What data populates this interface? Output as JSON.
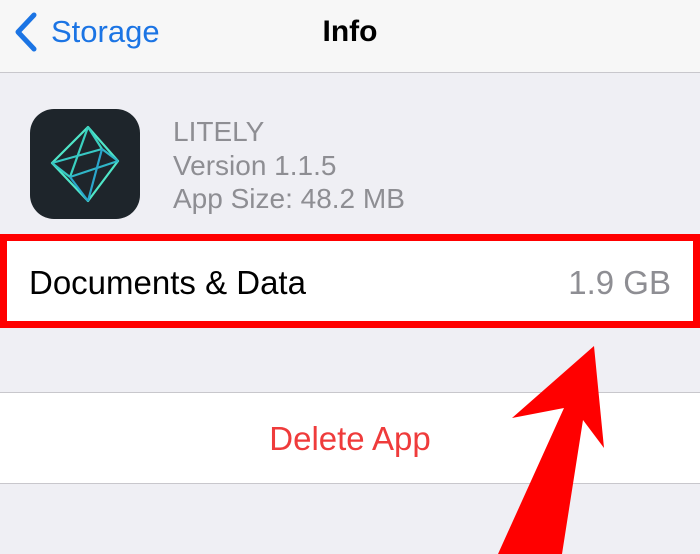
{
  "nav": {
    "back_label": "Storage",
    "title": "Info"
  },
  "app": {
    "name": "LITELY",
    "version": "Version 1.1.5",
    "size": "App Size: 48.2 MB",
    "icon": "litely-app-icon"
  },
  "documents": {
    "label": "Documents & Data",
    "value": "1.9 GB"
  },
  "delete": {
    "label": "Delete App"
  },
  "colors": {
    "accent": "#1b74e4",
    "destructive": "#ef3b3b",
    "secondary_text": "#8e8e93",
    "annotation": "#ff0000",
    "background": "#efeff4"
  }
}
